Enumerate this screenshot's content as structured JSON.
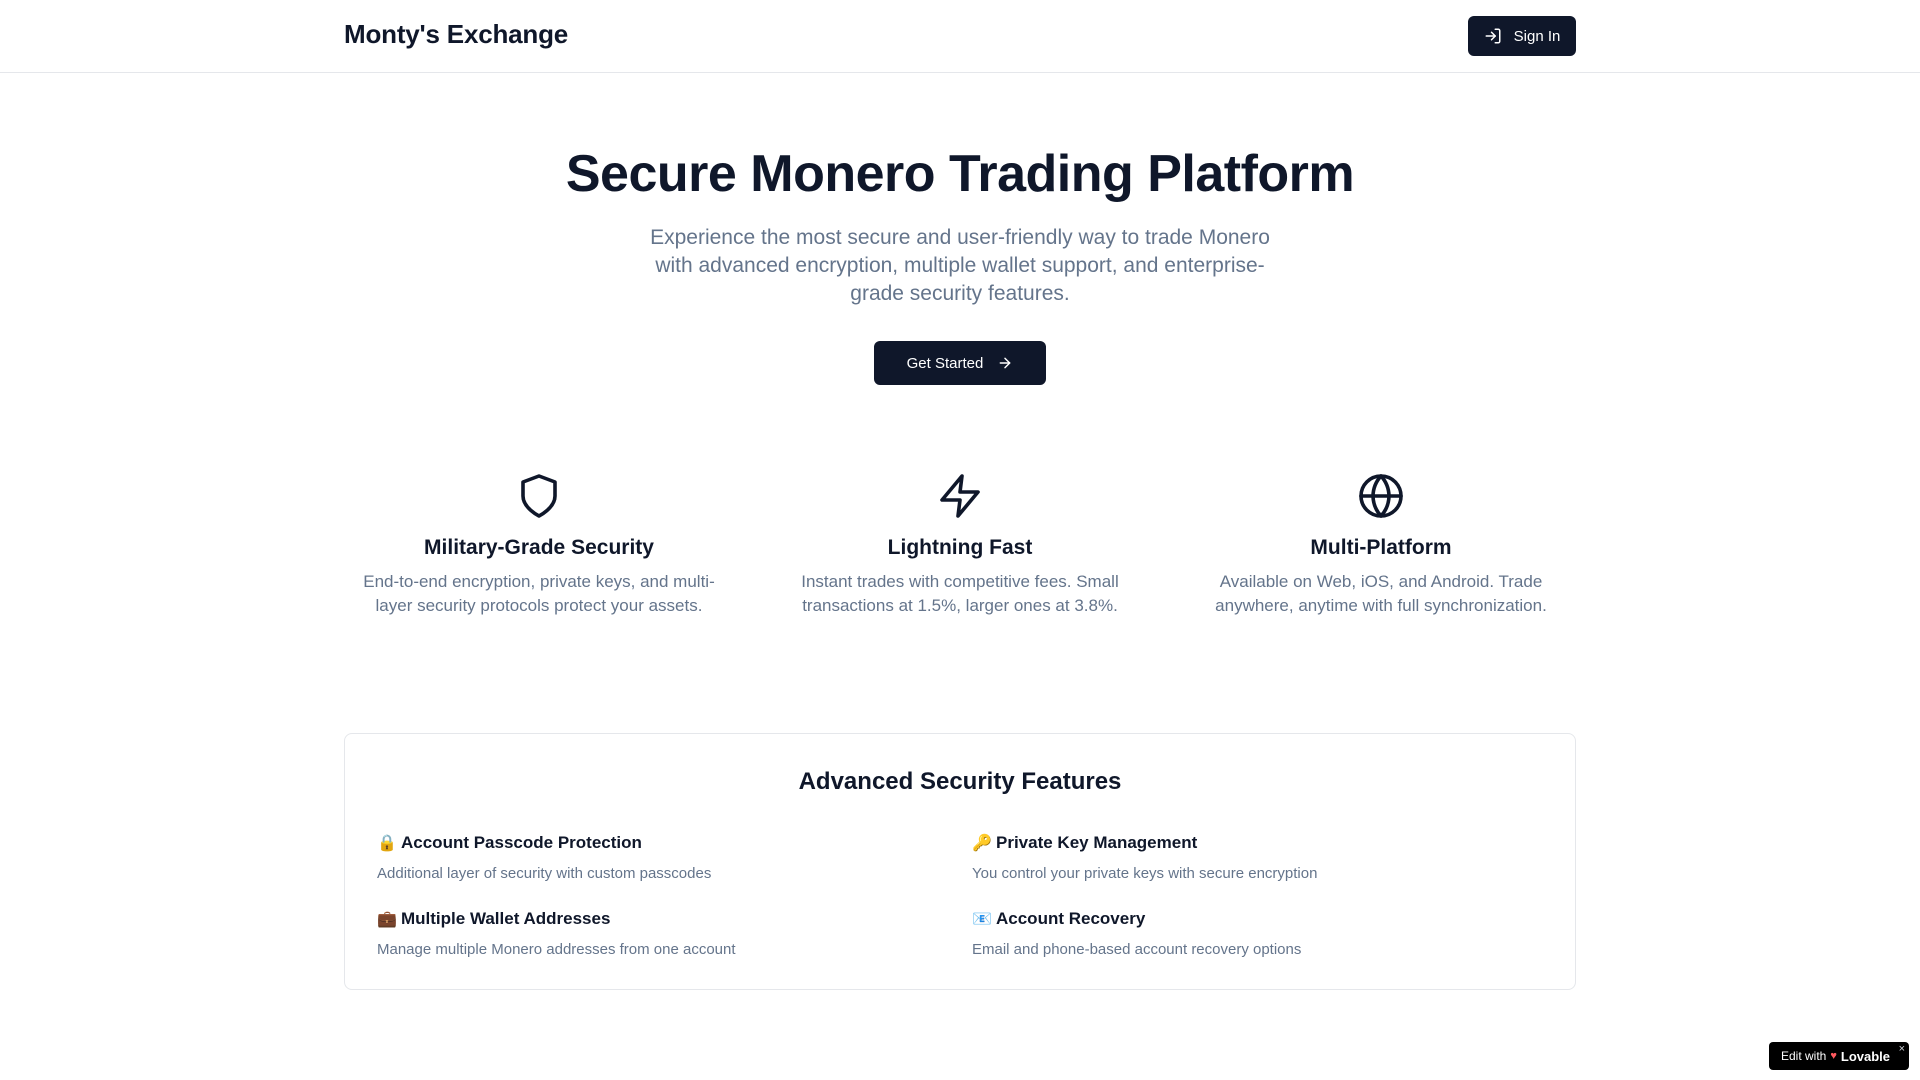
{
  "header": {
    "brand": "Monty's Exchange",
    "signin_label": "Sign In"
  },
  "hero": {
    "title": "Secure Monero Trading Platform",
    "subtitle": "Experience the most secure and user-friendly way to trade Monero with advanced encryption, multiple wallet support, and enterprise-grade security features.",
    "cta_label": "Get Started"
  },
  "features": [
    {
      "icon": "shield-icon",
      "title": "Military-Grade Security",
      "description": "End-to-end encryption, private keys, and multi-layer security protocols protect your assets."
    },
    {
      "icon": "lightning-icon",
      "title": "Lightning Fast",
      "description": "Instant trades with competitive fees. Small transactions at 1.5%, larger ones at 3.8%."
    },
    {
      "icon": "globe-icon",
      "title": "Multi-Platform",
      "description": "Available on Web, iOS, and Android. Trade anywhere, anytime with full synchronization."
    }
  ],
  "security": {
    "title": "Advanced Security Features",
    "items": [
      {
        "emoji": "🔒",
        "title": "Account Passcode Protection",
        "description": "Additional layer of security with custom passcodes"
      },
      {
        "emoji": "🔑",
        "title": "Private Key Management",
        "description": "You control your private keys with secure encryption"
      },
      {
        "emoji": "💼",
        "title": "Multiple Wallet Addresses",
        "description": "Manage multiple Monero addresses from one account"
      },
      {
        "emoji": "📧",
        "title": "Account Recovery",
        "description": "Email and phone-based account recovery options"
      }
    ]
  },
  "badge": {
    "prefix": "Edit with",
    "heart": "♥",
    "brand": "Lovable",
    "close": "×"
  },
  "colors": {
    "primary": "#0f172a",
    "muted_text": "#64748b",
    "border": "#e5e7eb",
    "background": "#ffffff"
  }
}
